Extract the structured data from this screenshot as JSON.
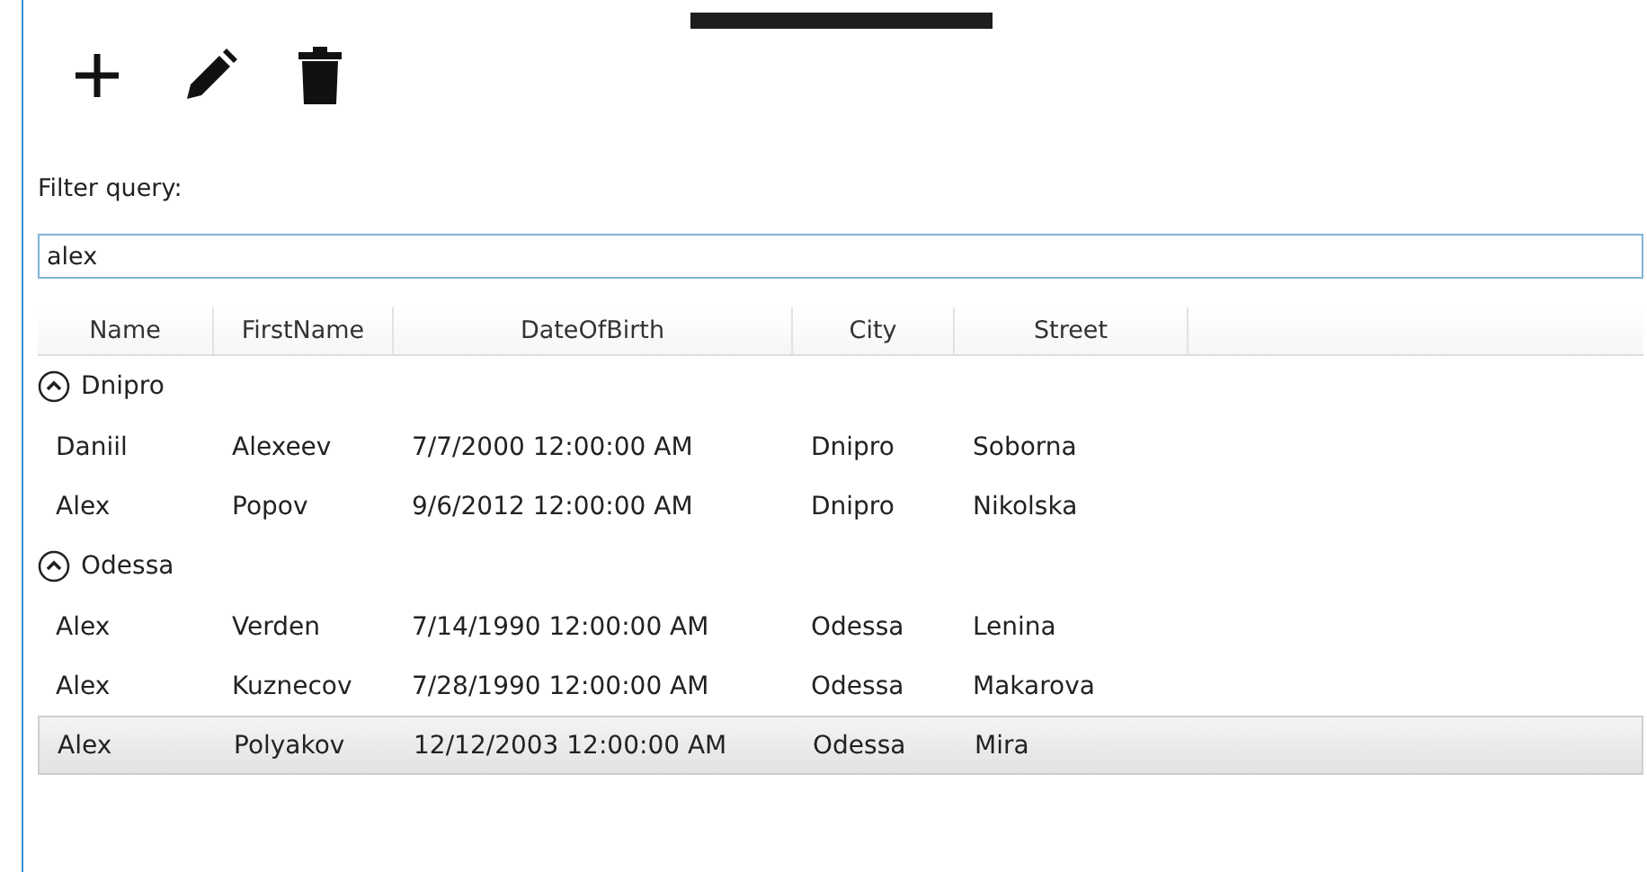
{
  "toolbar": {
    "buttons": [
      {
        "kind": "add"
      },
      {
        "kind": "edit"
      },
      {
        "kind": "delete"
      }
    ]
  },
  "filter": {
    "label": "Filter query:",
    "value": "alex"
  },
  "table": {
    "columns": [
      "Name",
      "FirstName",
      "DateOfBirth",
      "City",
      "Street"
    ],
    "groups": [
      {
        "name": "Dnipro",
        "expanded": true,
        "rows": [
          {
            "cells": [
              "Daniil",
              "Alexeev",
              "7/7/2000 12:00:00 AM",
              "Dnipro",
              "Soborna"
            ],
            "selected": false
          },
          {
            "cells": [
              "Alex",
              "Popov",
              "9/6/2012 12:00:00 AM",
              "Dnipro",
              "Nikolska"
            ],
            "selected": false
          }
        ]
      },
      {
        "name": "Odessa",
        "expanded": true,
        "rows": [
          {
            "cells": [
              "Alex",
              "Verden",
              "7/14/1990 12:00:00 AM",
              "Odessa",
              "Lenina"
            ],
            "selected": false
          },
          {
            "cells": [
              "Alex",
              "Kuznecov",
              "7/28/1990 12:00:00 AM",
              "Odessa",
              "Makarova"
            ],
            "selected": false
          },
          {
            "cells": [
              "Alex",
              "Polyakov",
              "12/12/2003 12:00:00 AM",
              "Odessa",
              "Mira"
            ],
            "selected": true
          }
        ]
      }
    ]
  }
}
